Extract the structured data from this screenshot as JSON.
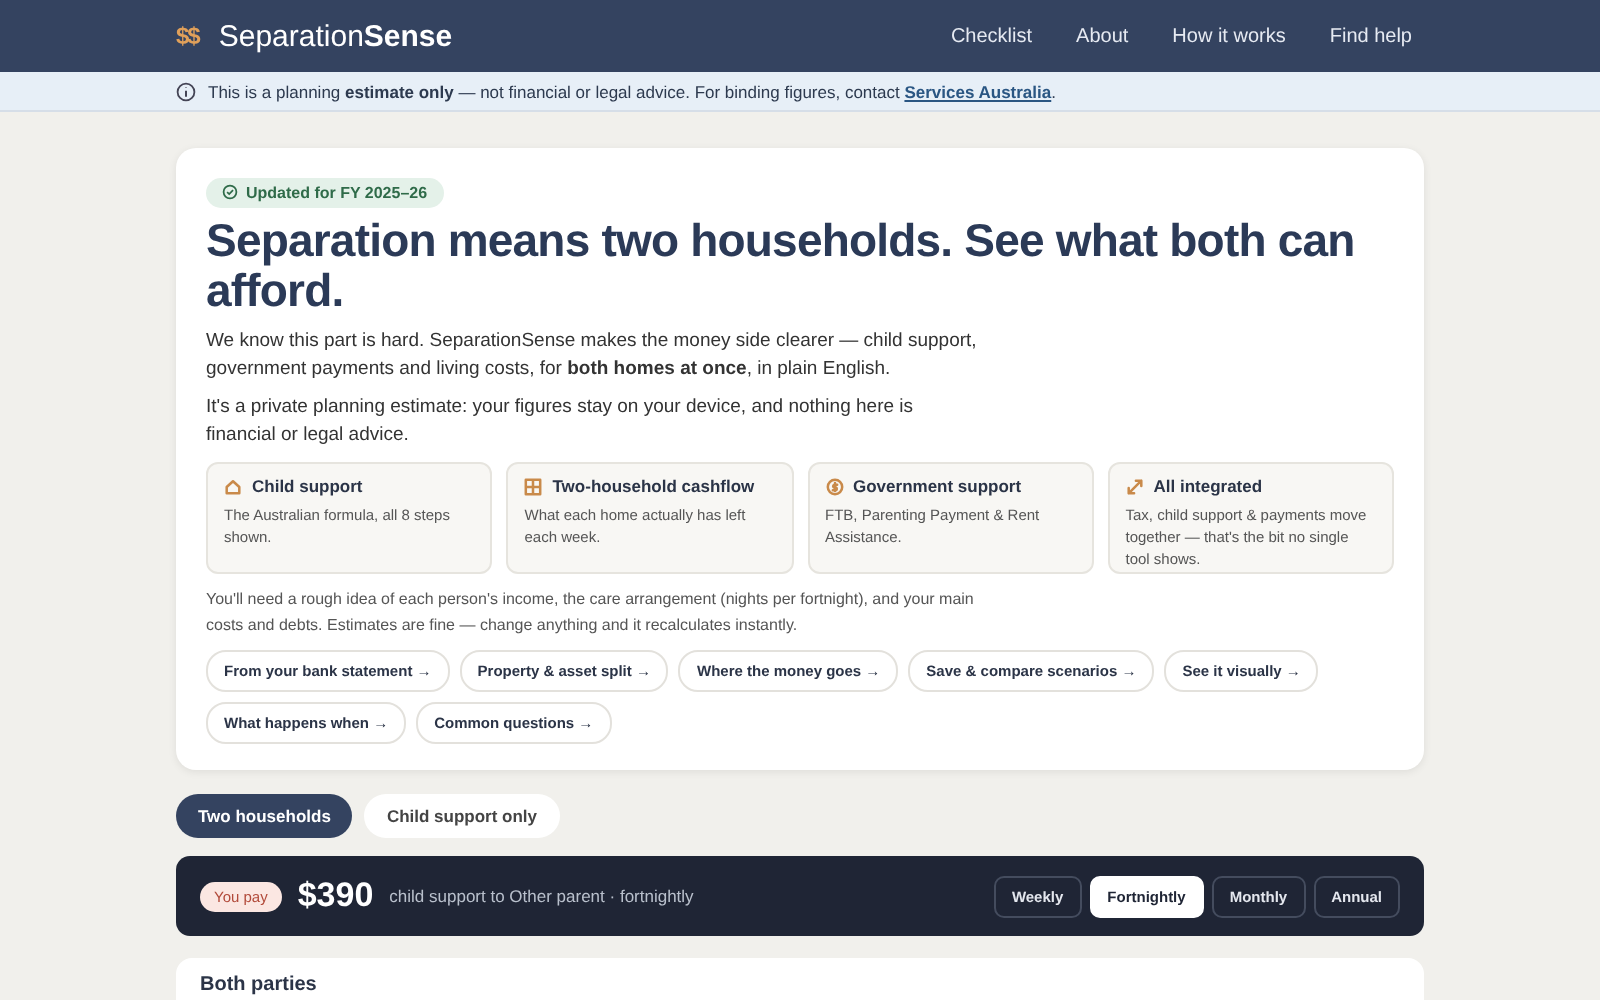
{
  "header": {
    "logo_mark": "$$",
    "brand_light": "Separation",
    "brand_bold": "Sense",
    "nav": [
      "Checklist",
      "About",
      "How it works",
      "Find help"
    ]
  },
  "notice": {
    "text": "This is a planning **estimate only** — not financial or legal advice. For binding figures, contact ",
    "link": "Services Australia",
    "end": "."
  },
  "hero": {
    "badge": "Updated for FY 2025–26",
    "title": "Separation means two households. See what both can afford.",
    "intro": "We know this part is hard. SeparationSense makes the money side clearer — child support, government payments and living costs, for **both homes at once**, in plain English.",
    "privacy": "It's a private planning estimate: your figures stay on your device, and nothing here is financial or legal advice.",
    "features": [
      {
        "kind": "house",
        "title": "Child support",
        "text": "The Australian formula, all 8 steps shown."
      },
      {
        "kind": "grid",
        "title": "Two-household cashflow",
        "text": "What each home actually has left each week."
      },
      {
        "kind": "dollar",
        "title": "Government support",
        "text": "FTB, Parenting Payment & Rent Assistance."
      },
      {
        "kind": "arrows",
        "title": "All integrated",
        "text": "Tax, child support & payments move together — that's the bit no single tool shows."
      }
    ],
    "needs": "You'll need a rough idea of each person's income, the care arrangement (nights per fortnight), and your main costs and debts. Estimates are fine — change anything and it recalculates instantly.",
    "links": [
      "From your bank statement →",
      "Property & asset split →",
      "Where the money goes →",
      "Save & compare scenarios →",
      "See it visually →",
      "What happens when →",
      "Common questions →"
    ]
  },
  "modes": [
    {
      "label": "Two households",
      "selected": true
    },
    {
      "label": "Child support only",
      "selected": false
    }
  ],
  "summary": {
    "badge": "You pay",
    "amount": "$390",
    "text": "child support to Other parent · fortnightly",
    "periods": [
      {
        "label": "Weekly",
        "selected": false
      },
      {
        "label": "Fortnightly",
        "selected": true
      },
      {
        "label": "Monthly",
        "selected": false
      },
      {
        "label": "Annual",
        "selected": false
      }
    ]
  },
  "section": {
    "title": "Both parties"
  }
}
